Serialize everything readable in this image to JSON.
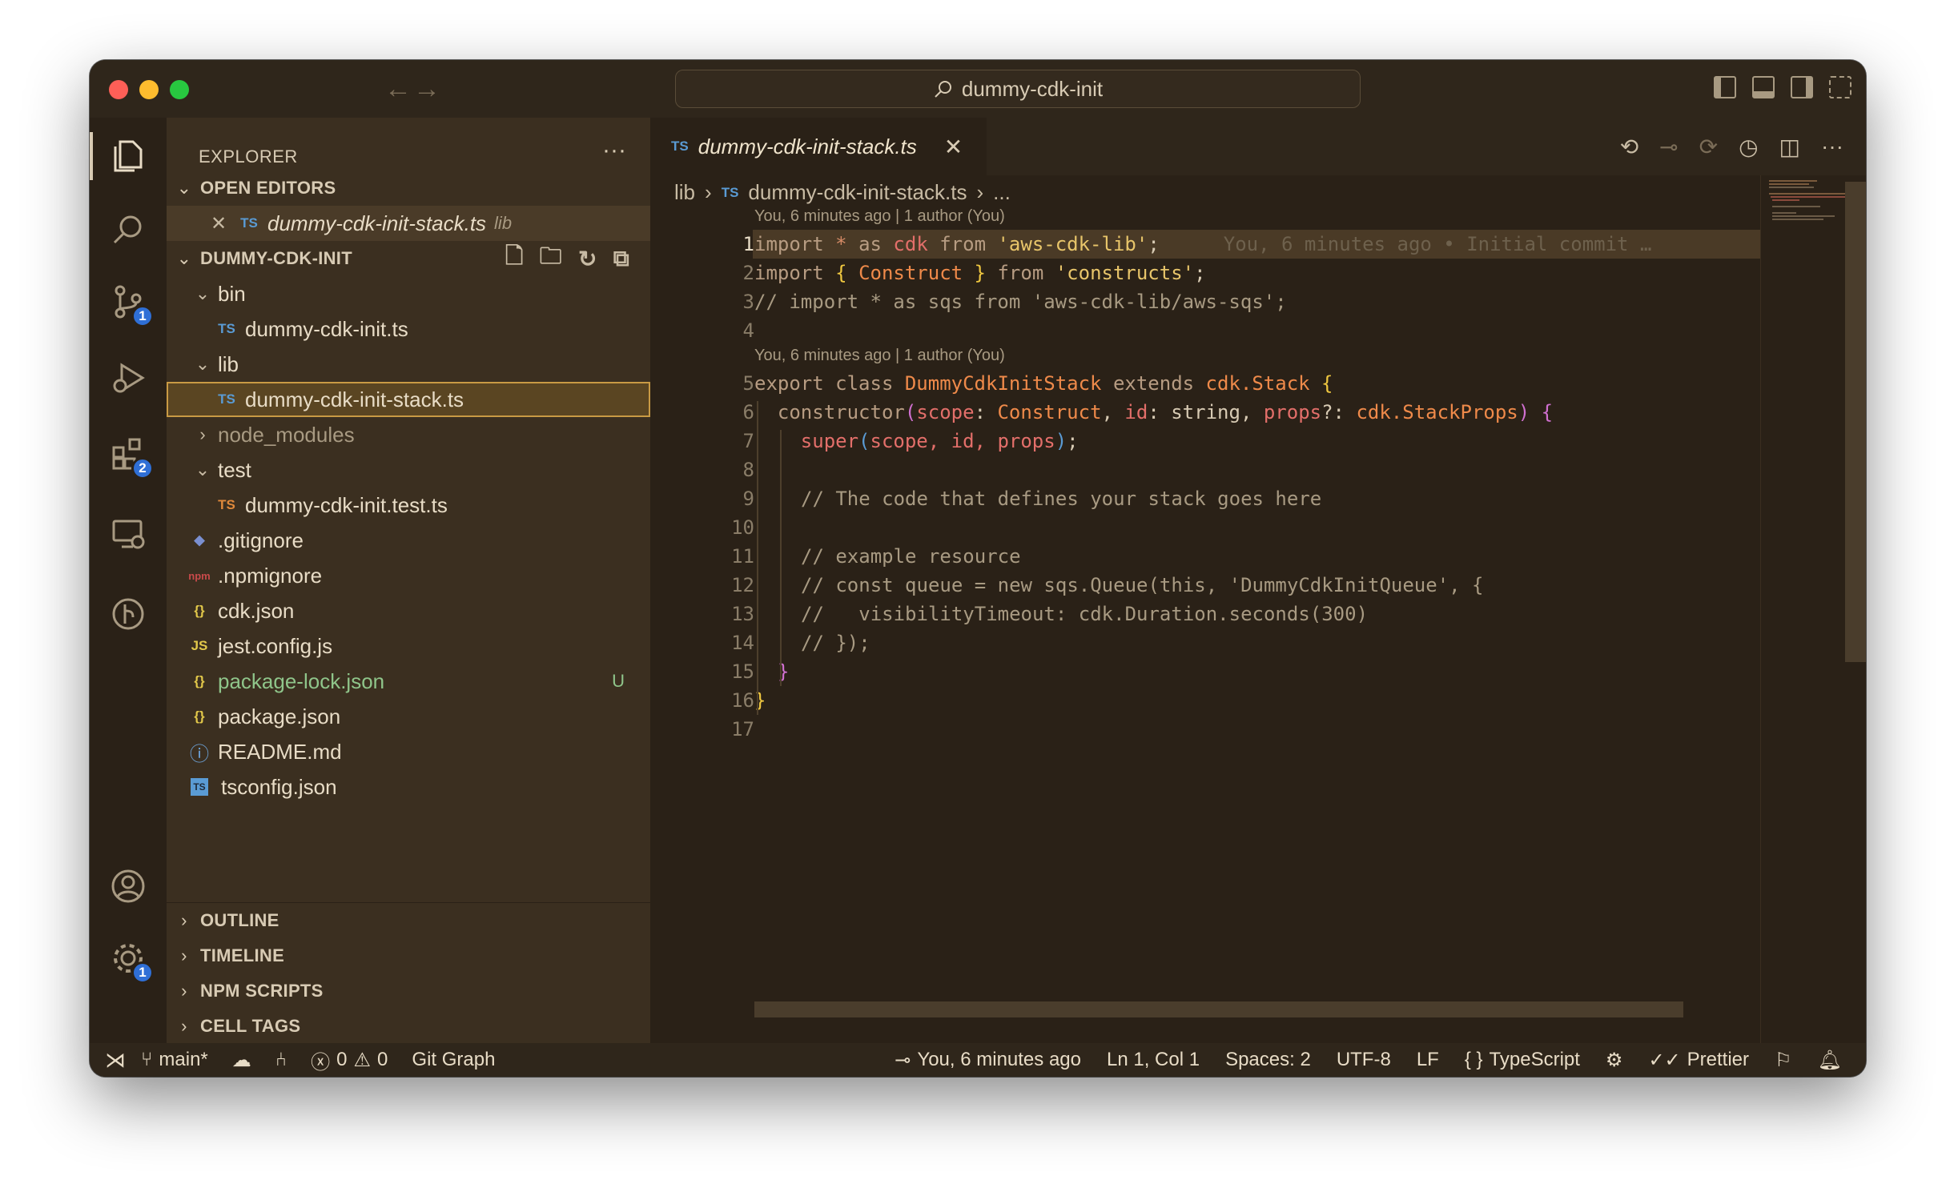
{
  "window": {
    "title": "dummy-cdk-init"
  },
  "activity": {
    "source_control_badge": "1",
    "extensions_badge": "2",
    "settings_badge": "1"
  },
  "sidebar": {
    "title": "EXPLORER",
    "more": "···",
    "open_editors": {
      "heading": "OPEN EDITORS",
      "items": [
        {
          "icon": "TS",
          "name": "dummy-cdk-init-stack.ts",
          "folder": "lib"
        }
      ]
    },
    "project": {
      "heading": "DUMMY-CDK-INIT",
      "tree": [
        {
          "type": "folder",
          "name": "bin"
        },
        {
          "type": "file",
          "icon": "TS",
          "name": "dummy-cdk-init.ts"
        },
        {
          "type": "folder",
          "name": "lib"
        },
        {
          "type": "file",
          "icon": "TS",
          "name": "dummy-cdk-init-stack.ts"
        },
        {
          "type": "folder-closed",
          "name": "node_modules"
        },
        {
          "type": "folder",
          "name": "test"
        },
        {
          "type": "file",
          "icon": "TS",
          "name": "dummy-cdk-init.test.ts"
        },
        {
          "type": "file",
          "icon": "◆",
          "name": ".gitignore"
        },
        {
          "type": "file",
          "icon": "npm",
          "name": ".npmignore"
        },
        {
          "type": "file",
          "icon": "{}",
          "name": "cdk.json"
        },
        {
          "type": "file",
          "icon": "JS",
          "name": "jest.config.js"
        },
        {
          "type": "file",
          "icon": "{}",
          "name": "package-lock.json",
          "status": "U"
        },
        {
          "type": "file",
          "icon": "{}",
          "name": "package.json"
        },
        {
          "type": "file",
          "icon": "ⓘ",
          "name": "README.md"
        },
        {
          "type": "file",
          "icon": "TS",
          "name": "tsconfig.json"
        }
      ]
    },
    "bottom_sections": [
      "OUTLINE",
      "TIMELINE",
      "NPM SCRIPTS",
      "CELL TAGS"
    ]
  },
  "editor": {
    "tab": {
      "icon": "TS",
      "name": "dummy-cdk-init-stack.ts",
      "close": "✕"
    },
    "breadcrumb": {
      "folder": "lib",
      "icon": "TS",
      "file": "dummy-cdk-init-stack.ts",
      "more": "..."
    },
    "codelens_1": "You, 6 minutes ago | 1 author (You)",
    "codelens_2": "You, 6 minutes ago | 1 author (You)",
    "blame": "You, 6 minutes ago • Initial commit …",
    "line_numbers": [
      "1",
      "2",
      "3",
      "4",
      "5",
      "6",
      "7",
      "8",
      "9",
      "10",
      "11",
      "12",
      "13",
      "14",
      "15",
      "16",
      "17"
    ],
    "lines": {
      "l1": {
        "import": "import",
        "star": " * ",
        "as": "as",
        "cdk": " cdk ",
        "from": "from",
        "str": " 'aws-cdk-lib'",
        "semi": ";"
      },
      "l2": {
        "import": "import",
        "open": " { ",
        "name": "Construct",
        "close": " } ",
        "from": "from",
        "str": " 'constructs'",
        "semi": ";"
      },
      "l3": "// import * as sqs from 'aws-cdk-lib/aws-sqs';",
      "l5": {
        "export": "export",
        "class": " class ",
        "name": "DummyCdkInitStack",
        "extends": " extends ",
        "base": "cdk.Stack",
        "brace": " {"
      },
      "l6": {
        "ctor": "constructor",
        "p1": "scope",
        "t1": "Construct",
        "p2": "id",
        "t2": "string",
        "p3": "props",
        "t3": "cdk.StackProps"
      },
      "l7": {
        "super": "super",
        "args": "scope, id, props"
      },
      "l9": "// The code that defines your stack goes here",
      "l11": "// example resource",
      "l12": "// const queue = new sqs.Queue(this, 'DummyCdkInitQueue', {",
      "l13": "//   visibilityTimeout: cdk.Duration.seconds(300)",
      "l14": "// });",
      "l15": "}",
      "l16": "}"
    }
  },
  "status": {
    "branch": "main*",
    "errors": "0",
    "warnings": "0",
    "git_graph": "Git Graph",
    "blame": "You, 6 minutes ago",
    "position": "Ln 1, Col 1",
    "spaces": "Spaces: 2",
    "encoding": "UTF-8",
    "eol": "LF",
    "language": "TypeScript",
    "prettier": "Prettier"
  }
}
